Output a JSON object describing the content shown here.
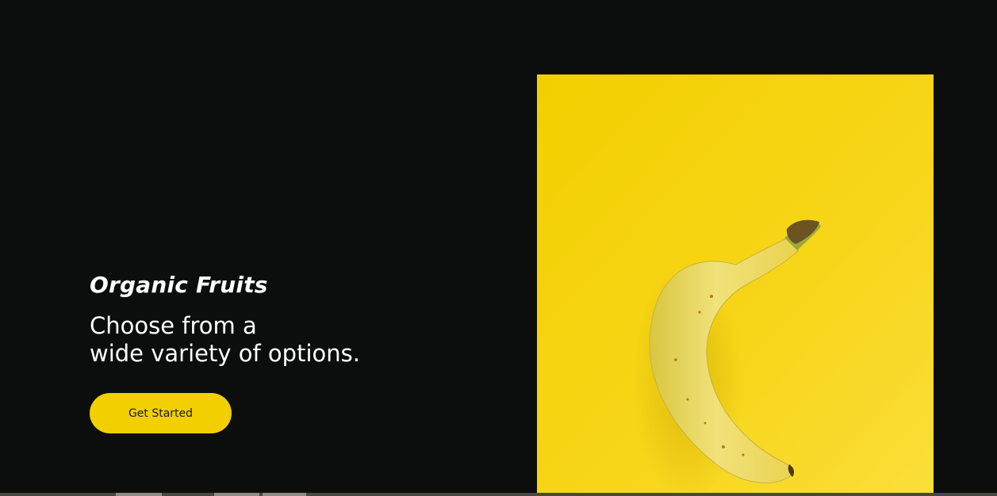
{
  "hero": {
    "eyebrow": "Organic Fruits",
    "headline_line1": "Choose from a",
    "headline_line2": "wide variety of options.",
    "cta_label": "Get Started"
  },
  "image": {
    "subject": "banana-on-yellow-background"
  },
  "colors": {
    "background": "#0c0e0e",
    "accent": "#f2cf00",
    "text": "#ffffff"
  }
}
